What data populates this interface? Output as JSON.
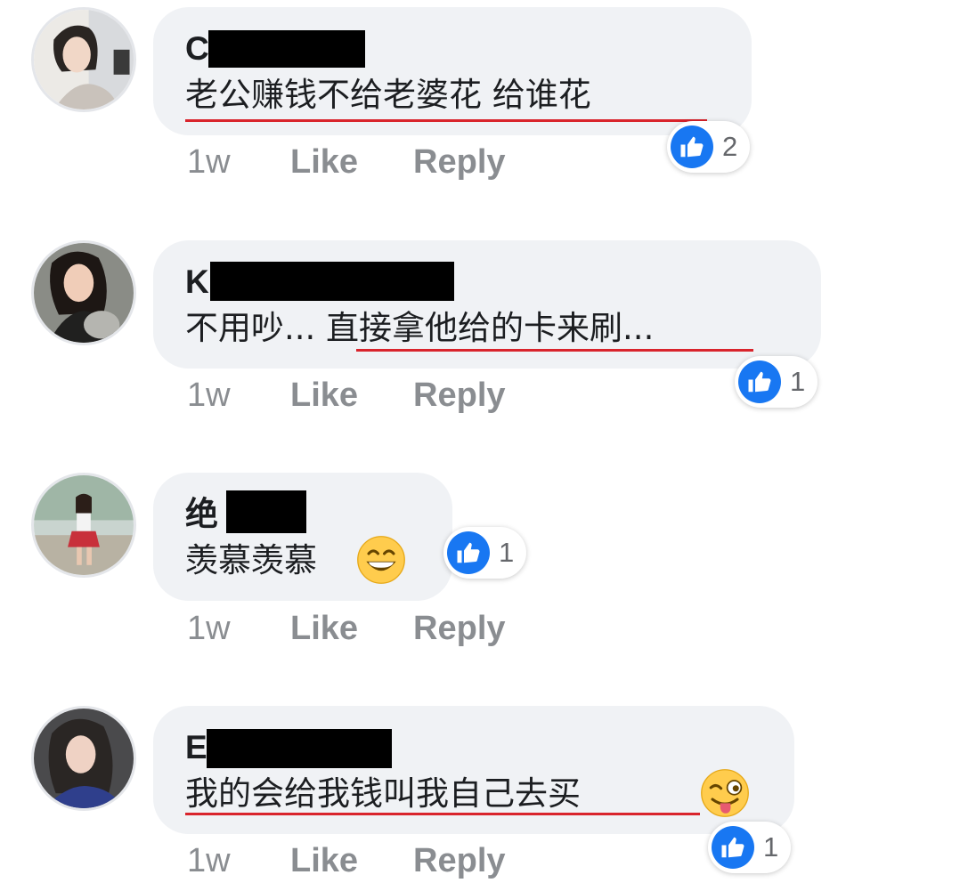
{
  "comments": [
    {
      "author_visible": "C",
      "text": "老公赚钱不给老婆花 给谁花",
      "timestamp": "1w",
      "like_label": "Like",
      "reply_label": "Reply",
      "reaction_icon": "thumbs-up-icon",
      "reaction_count": "2",
      "underlined": true
    },
    {
      "author_visible": "K",
      "text_prefix": "不用吵... ",
      "text": "直接拿他给的卡来刷...",
      "timestamp": "1w",
      "like_label": "Like",
      "reply_label": "Reply",
      "reaction_icon": "thumbs-up-icon",
      "reaction_count": "1",
      "underlined": true
    },
    {
      "author_visible": "绝",
      "text": "羡慕羡慕",
      "emoji": "grinning-face-emoji",
      "timestamp": "1w",
      "like_label": "Like",
      "reply_label": "Reply",
      "reaction_icon": "thumbs-up-icon",
      "reaction_count": "1",
      "underlined": false
    },
    {
      "author_visible": "E",
      "text": "我的会给我钱叫我自己去买",
      "emoji": "winking-face-tongue-emoji",
      "timestamp": "1w",
      "like_label": "Like",
      "reply_label": "Reply",
      "reaction_icon": "thumbs-up-icon",
      "reaction_count": "1",
      "underlined": true
    }
  ],
  "colors": {
    "bubble": "#f0f2f5",
    "like_blue": "#1877f2",
    "underline_red": "#d9242c",
    "action_grey": "#8a8d91",
    "redaction": "#000000"
  }
}
